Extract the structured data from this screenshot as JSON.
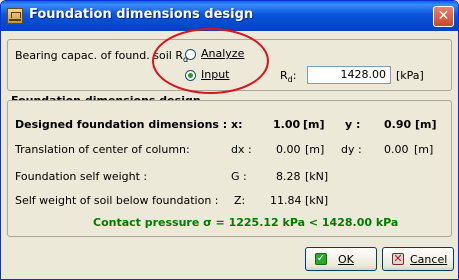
{
  "window": {
    "title": "Foundation dimensions design",
    "close_glyph": "✕"
  },
  "bearing": {
    "label": "Bearing capac. of found. soil R",
    "label_sub": "d",
    "label_suffix": ":",
    "option_analyze": "Analyze",
    "option_input": "Input",
    "selected": "Input",
    "rd_label": "R",
    "rd_sub": "d",
    "rd_colon": ":",
    "rd_value": "1428.00",
    "rd_unit": "[kPa]"
  },
  "design": {
    "group_title": "Foundation dimensions design",
    "designed_label": "Designed foundation dimensions :",
    "x_label": "x:",
    "x_value": "1.00",
    "x_unit": "[m]",
    "y_label": "y :",
    "y_value": "0.90",
    "y_unit": "[m]",
    "translation_label": "Translation of center of column:",
    "dx_label": "dx :",
    "dx_value": "0.00",
    "dx_unit": "[m]",
    "dy_label": "dy :",
    "dy_value": "0.00",
    "dy_unit": "[m]",
    "self_weight_label": "Foundation self weight :",
    "g_label": "G :",
    "g_value": "8.28",
    "g_unit": "[kN]",
    "soil_weight_label": "Self weight of soil below foundation :",
    "z_label": "Z:",
    "z_value": "11.84",
    "z_unit": "[kN]",
    "contact_pressure": "Contact pressure σ = 1225.12 kPa < 1428.00 kPa"
  },
  "buttons": {
    "ok_label": "OK",
    "ok_icon_glyph": "✓",
    "cancel_label": "Cancel",
    "cancel_icon_glyph": "✕"
  },
  "colors": {
    "title_bar": "#0a56dd",
    "highlight_ellipse": "#e0101a",
    "contact_text": "#007a00"
  }
}
